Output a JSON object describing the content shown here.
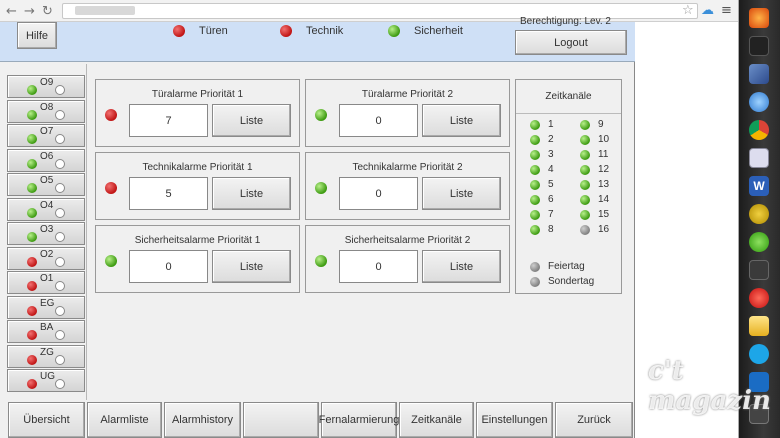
{
  "header": {
    "help_label": "Hilfe",
    "logout_label": "Logout",
    "status_cut_text": "Berechtigung: Lev. 2",
    "indicators": [
      {
        "label": "Türen",
        "state": "red"
      },
      {
        "label": "Technik",
        "state": "red"
      },
      {
        "label": "Sicherheit",
        "state": "green"
      }
    ]
  },
  "floors": [
    {
      "label": "O9",
      "state": "green"
    },
    {
      "label": "O8",
      "state": "green"
    },
    {
      "label": "O7",
      "state": "green"
    },
    {
      "label": "O6",
      "state": "green"
    },
    {
      "label": "O5",
      "state": "green"
    },
    {
      "label": "O4",
      "state": "green"
    },
    {
      "label": "O3",
      "state": "green"
    },
    {
      "label": "O2",
      "state": "red"
    },
    {
      "label": "O1",
      "state": "red"
    },
    {
      "label": "EG",
      "state": "red"
    },
    {
      "label": "BA",
      "state": "red"
    },
    {
      "label": "ZG",
      "state": "red"
    },
    {
      "label": "UG",
      "state": "red"
    }
  ],
  "alarms": [
    {
      "title": "Türalarme Priorität 1",
      "value": "7",
      "state": "red"
    },
    {
      "title": "Türalarme Priorität 2",
      "value": "0",
      "state": "green"
    },
    {
      "title": "Technikalarme Priorität 1",
      "value": "5",
      "state": "red"
    },
    {
      "title": "Technikalarme Priorität 2",
      "value": "0",
      "state": "green"
    },
    {
      "title": "Sicherheitsalarme Priorität 1",
      "value": "0",
      "state": "green"
    },
    {
      "title": "Sicherheitsalarme Priorität 2",
      "value": "0",
      "state": "green"
    }
  ],
  "list_button_label": "Liste",
  "zeitkanaele": {
    "title": "Zeitkanäle",
    "left": [
      {
        "num": "1",
        "state": "green"
      },
      {
        "num": "2",
        "state": "green"
      },
      {
        "num": "3",
        "state": "green"
      },
      {
        "num": "4",
        "state": "green"
      },
      {
        "num": "5",
        "state": "green"
      },
      {
        "num": "6",
        "state": "green"
      },
      {
        "num": "7",
        "state": "green"
      },
      {
        "num": "8",
        "state": "green"
      }
    ],
    "right": [
      {
        "num": "9",
        "state": "green"
      },
      {
        "num": "10",
        "state": "green"
      },
      {
        "num": "11",
        "state": "green"
      },
      {
        "num": "12",
        "state": "green"
      },
      {
        "num": "13",
        "state": "green"
      },
      {
        "num": "14",
        "state": "green"
      },
      {
        "num": "15",
        "state": "green"
      },
      {
        "num": "16",
        "state": "gray"
      }
    ],
    "extra": [
      {
        "label": "Feiertag",
        "state": "gray"
      },
      {
        "label": "Sondertag",
        "state": "gray"
      }
    ]
  },
  "nav": [
    {
      "label": "Übersicht"
    },
    {
      "label": "Alarmliste"
    },
    {
      "label": "Alarmhistory"
    },
    {
      "label": ""
    },
    {
      "label": "Fernalarmierung"
    },
    {
      "label": "Zeitkanäle"
    },
    {
      "label": "Einstellungen"
    },
    {
      "label": "Zurück"
    }
  ],
  "watermark": "c't magazin"
}
